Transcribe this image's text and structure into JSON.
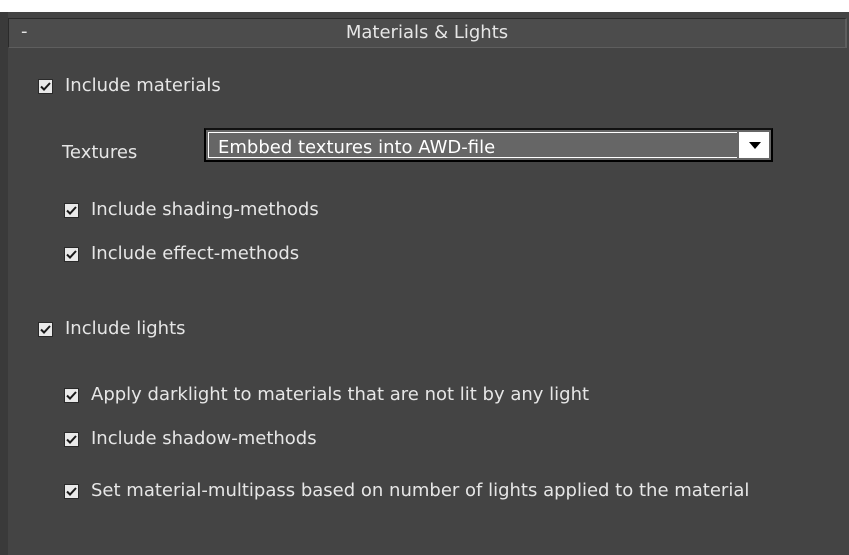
{
  "rollout": {
    "toggle": "-",
    "title": "Materials & Lights"
  },
  "materials": {
    "include_materials": {
      "label": "Include materials",
      "checked": true
    },
    "textures_label": "Textures",
    "textures_select": {
      "value": "Embbed textures into AWD-file"
    },
    "include_shading": {
      "label": "Include shading-methods",
      "checked": true
    },
    "include_effect": {
      "label": "Include effect-methods",
      "checked": true
    }
  },
  "lights": {
    "include_lights": {
      "label": "Include lights",
      "checked": true
    },
    "apply_darklight": {
      "label": "Apply darklight to materials that are not lit by any light",
      "checked": true
    },
    "include_shadow": {
      "label": "Include shadow-methods",
      "checked": true
    },
    "set_multipass": {
      "label": "Set material-multipass based on number of lights applied to the material",
      "checked": true
    }
  },
  "colors": {
    "panel_bg": "#444444",
    "text": "#e6e6e6",
    "dropdown_bg": "#666666"
  },
  "icons": {
    "checkbox_tick": "check-icon",
    "dropdown_arrow": "chevron-down-icon"
  }
}
